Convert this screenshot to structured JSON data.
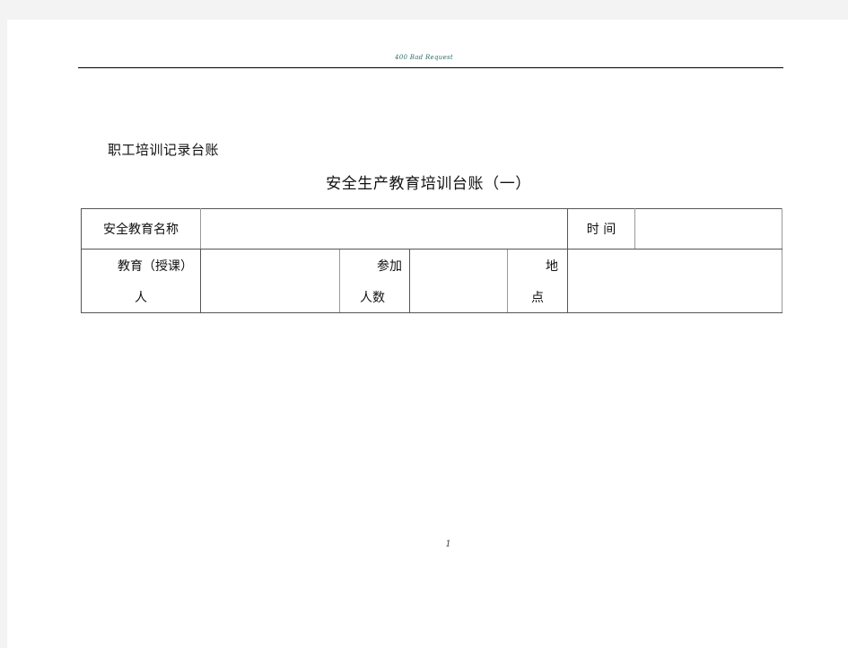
{
  "header": {
    "text": "400 Bad Request"
  },
  "document": {
    "subtitle": "职工培训记录台账",
    "title": "安全生产教育培训台账（一）"
  },
  "table": {
    "row1": {
      "name_label": "安全教育名称",
      "name_value": "",
      "time_label": "时 间",
      "time_value": ""
    },
    "row2": {
      "instructor_label_line1": "教育（授课）",
      "instructor_label_line2": "人",
      "instructor_value": "",
      "participants_label_line1": "参加",
      "participants_label_line2": "人数",
      "participants_value": "",
      "place_label_line1": "地",
      "place_label_line2": "点",
      "place_value": ""
    }
  },
  "footer": {
    "page_number": "1"
  }
}
